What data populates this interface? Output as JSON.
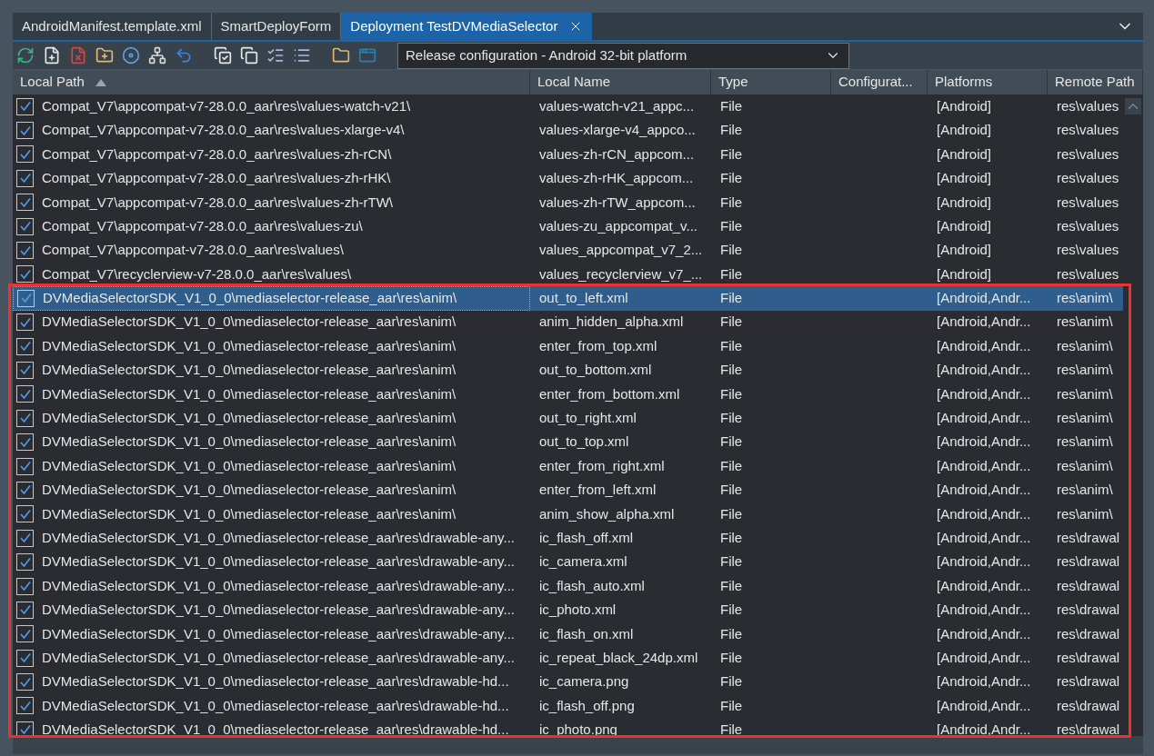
{
  "tabs": [
    {
      "label": "AndroidManifest.template.xml",
      "selected": false
    },
    {
      "label": "SmartDeployForm",
      "selected": false
    },
    {
      "label": "Deployment TestDVMediaSelector",
      "selected": true
    }
  ],
  "configuration": {
    "value": "Release configuration - Android 32-bit platform"
  },
  "table": {
    "columns": [
      "Local Path",
      "Local Name",
      "Type",
      "Configurat...",
      "Platforms",
      "Remote Path"
    ],
    "rows": [
      {
        "checked": true,
        "selected": false,
        "cells": [
          "Compat_V7\\appcompat-v7-28.0.0_aar\\res\\values-watch-v21\\",
          "values-watch-v21_appc...",
          "File",
          "",
          "[Android]",
          "res\\values"
        ]
      },
      {
        "checked": true,
        "selected": false,
        "cells": [
          "Compat_V7\\appcompat-v7-28.0.0_aar\\res\\values-xlarge-v4\\",
          "values-xlarge-v4_appco...",
          "File",
          "",
          "[Android]",
          "res\\values"
        ]
      },
      {
        "checked": true,
        "selected": false,
        "cells": [
          "Compat_V7\\appcompat-v7-28.0.0_aar\\res\\values-zh-rCN\\",
          "values-zh-rCN_appcom...",
          "File",
          "",
          "[Android]",
          "res\\values"
        ]
      },
      {
        "checked": true,
        "selected": false,
        "cells": [
          "Compat_V7\\appcompat-v7-28.0.0_aar\\res\\values-zh-rHK\\",
          "values-zh-rHK_appcom...",
          "File",
          "",
          "[Android]",
          "res\\values"
        ]
      },
      {
        "checked": true,
        "selected": false,
        "cells": [
          "Compat_V7\\appcompat-v7-28.0.0_aar\\res\\values-zh-rTW\\",
          "values-zh-rTW_appcom...",
          "File",
          "",
          "[Android]",
          "res\\values"
        ]
      },
      {
        "checked": true,
        "selected": false,
        "cells": [
          "Compat_V7\\appcompat-v7-28.0.0_aar\\res\\values-zu\\",
          "values-zu_appcompat_v...",
          "File",
          "",
          "[Android]",
          "res\\values"
        ]
      },
      {
        "checked": true,
        "selected": false,
        "cells": [
          "Compat_V7\\appcompat-v7-28.0.0_aar\\res\\values\\",
          "values_appcompat_v7_2...",
          "File",
          "",
          "[Android]",
          "res\\values"
        ]
      },
      {
        "checked": true,
        "selected": false,
        "cells": [
          "Compat_V7\\recyclerview-v7-28.0.0_aar\\res\\values\\",
          "values_recyclerview_v7_...",
          "File",
          "",
          "[Android]",
          "res\\values"
        ]
      },
      {
        "checked": true,
        "selected": true,
        "cells": [
          "DVMediaSelectorSDK_V1_0_0\\mediaselector-release_aar\\res\\anim\\",
          "out_to_left.xml",
          "File",
          "",
          "[Android,Andr...",
          "res\\anim\\"
        ]
      },
      {
        "checked": true,
        "selected": false,
        "cells": [
          "DVMediaSelectorSDK_V1_0_0\\mediaselector-release_aar\\res\\anim\\",
          "anim_hidden_alpha.xml",
          "File",
          "",
          "[Android,Andr...",
          "res\\anim\\"
        ]
      },
      {
        "checked": true,
        "selected": false,
        "cells": [
          "DVMediaSelectorSDK_V1_0_0\\mediaselector-release_aar\\res\\anim\\",
          "enter_from_top.xml",
          "File",
          "",
          "[Android,Andr...",
          "res\\anim\\"
        ]
      },
      {
        "checked": true,
        "selected": false,
        "cells": [
          "DVMediaSelectorSDK_V1_0_0\\mediaselector-release_aar\\res\\anim\\",
          "out_to_bottom.xml",
          "File",
          "",
          "[Android,Andr...",
          "res\\anim\\"
        ]
      },
      {
        "checked": true,
        "selected": false,
        "cells": [
          "DVMediaSelectorSDK_V1_0_0\\mediaselector-release_aar\\res\\anim\\",
          "enter_from_bottom.xml",
          "File",
          "",
          "[Android,Andr...",
          "res\\anim\\"
        ]
      },
      {
        "checked": true,
        "selected": false,
        "cells": [
          "DVMediaSelectorSDK_V1_0_0\\mediaselector-release_aar\\res\\anim\\",
          "out_to_right.xml",
          "File",
          "",
          "[Android,Andr...",
          "res\\anim\\"
        ]
      },
      {
        "checked": true,
        "selected": false,
        "cells": [
          "DVMediaSelectorSDK_V1_0_0\\mediaselector-release_aar\\res\\anim\\",
          "out_to_top.xml",
          "File",
          "",
          "[Android,Andr...",
          "res\\anim\\"
        ]
      },
      {
        "checked": true,
        "selected": false,
        "cells": [
          "DVMediaSelectorSDK_V1_0_0\\mediaselector-release_aar\\res\\anim\\",
          "enter_from_right.xml",
          "File",
          "",
          "[Android,Andr...",
          "res\\anim\\"
        ]
      },
      {
        "checked": true,
        "selected": false,
        "cells": [
          "DVMediaSelectorSDK_V1_0_0\\mediaselector-release_aar\\res\\anim\\",
          "enter_from_left.xml",
          "File",
          "",
          "[Android,Andr...",
          "res\\anim\\"
        ]
      },
      {
        "checked": true,
        "selected": false,
        "cells": [
          "DVMediaSelectorSDK_V1_0_0\\mediaselector-release_aar\\res\\anim\\",
          "anim_show_alpha.xml",
          "File",
          "",
          "[Android,Andr...",
          "res\\anim\\"
        ]
      },
      {
        "checked": true,
        "selected": false,
        "cells": [
          "DVMediaSelectorSDK_V1_0_0\\mediaselector-release_aar\\res\\drawable-any...",
          "ic_flash_off.xml",
          "File",
          "",
          "[Android,Andr...",
          "res\\drawal"
        ]
      },
      {
        "checked": true,
        "selected": false,
        "cells": [
          "DVMediaSelectorSDK_V1_0_0\\mediaselector-release_aar\\res\\drawable-any...",
          "ic_camera.xml",
          "File",
          "",
          "[Android,Andr...",
          "res\\drawal"
        ]
      },
      {
        "checked": true,
        "selected": false,
        "cells": [
          "DVMediaSelectorSDK_V1_0_0\\mediaselector-release_aar\\res\\drawable-any...",
          "ic_flash_auto.xml",
          "File",
          "",
          "[Android,Andr...",
          "res\\drawal"
        ]
      },
      {
        "checked": true,
        "selected": false,
        "cells": [
          "DVMediaSelectorSDK_V1_0_0\\mediaselector-release_aar\\res\\drawable-any...",
          "ic_photo.xml",
          "File",
          "",
          "[Android,Andr...",
          "res\\drawal"
        ]
      },
      {
        "checked": true,
        "selected": false,
        "cells": [
          "DVMediaSelectorSDK_V1_0_0\\mediaselector-release_aar\\res\\drawable-any...",
          "ic_flash_on.xml",
          "File",
          "",
          "[Android,Andr...",
          "res\\drawal"
        ]
      },
      {
        "checked": true,
        "selected": false,
        "cells": [
          "DVMediaSelectorSDK_V1_0_0\\mediaselector-release_aar\\res\\drawable-any...",
          "ic_repeat_black_24dp.xml",
          "File",
          "",
          "[Android,Andr...",
          "res\\drawal"
        ]
      },
      {
        "checked": true,
        "selected": false,
        "cells": [
          "DVMediaSelectorSDK_V1_0_0\\mediaselector-release_aar\\res\\drawable-hd...",
          "ic_camera.png",
          "File",
          "",
          "[Android,Andr...",
          "res\\drawal"
        ]
      },
      {
        "checked": true,
        "selected": false,
        "cells": [
          "DVMediaSelectorSDK_V1_0_0\\mediaselector-release_aar\\res\\drawable-hd...",
          "ic_flash_off.png",
          "File",
          "",
          "[Android,Andr...",
          "res\\drawal"
        ]
      },
      {
        "checked": true,
        "selected": false,
        "cells": [
          "DVMediaSelectorSDK_V1_0_0\\mediaselector-release_aar\\res\\drawable-hd...",
          "ic_photo.png",
          "File",
          "",
          "[Android,Andr...",
          "res\\drawal"
        ]
      }
    ]
  }
}
